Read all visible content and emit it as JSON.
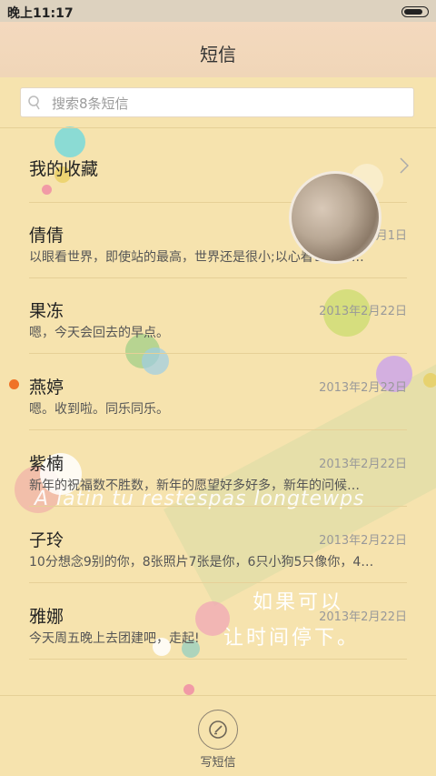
{
  "status_bar": {
    "time": "晚上11:17",
    "battery_level": 0.85
  },
  "header": {
    "title": "短信"
  },
  "search": {
    "placeholder": "搜索8条短信"
  },
  "favorites": {
    "label": "我的收藏"
  },
  "conversations": [
    {
      "name": "倩倩",
      "date": "2013年3月1日",
      "preview": "以眼看世界，即使站的最高，世界还是很小;以心看世界，…"
    },
    {
      "name": "果冻",
      "date": "2013年2月22日",
      "preview": "嗯，今天会回去的早点。"
    },
    {
      "name": "燕婷",
      "date": "2013年2月22日",
      "preview": "嗯。收到啦。同乐同乐。"
    },
    {
      "name": "紫楠",
      "date": "2013年2月22日",
      "preview": "新年的祝福数不胜数，新年的愿望好多好多，新年的问候…"
    },
    {
      "name": "子玲",
      "date": "2013年2月22日",
      "preview": "10分想念9别的你，8张照片7张是你，6只小狗5只像你，4…"
    },
    {
      "name": "雅娜",
      "date": "2013年2月22日",
      "preview": "今天周五晚上去团建吧，走起!"
    }
  ],
  "wallpaper": {
    "script_text": "A latin tu restespas longtewps",
    "cn_line1": "如果可以",
    "cn_line2": "让时间停下。"
  },
  "compose": {
    "label": "写短信"
  }
}
